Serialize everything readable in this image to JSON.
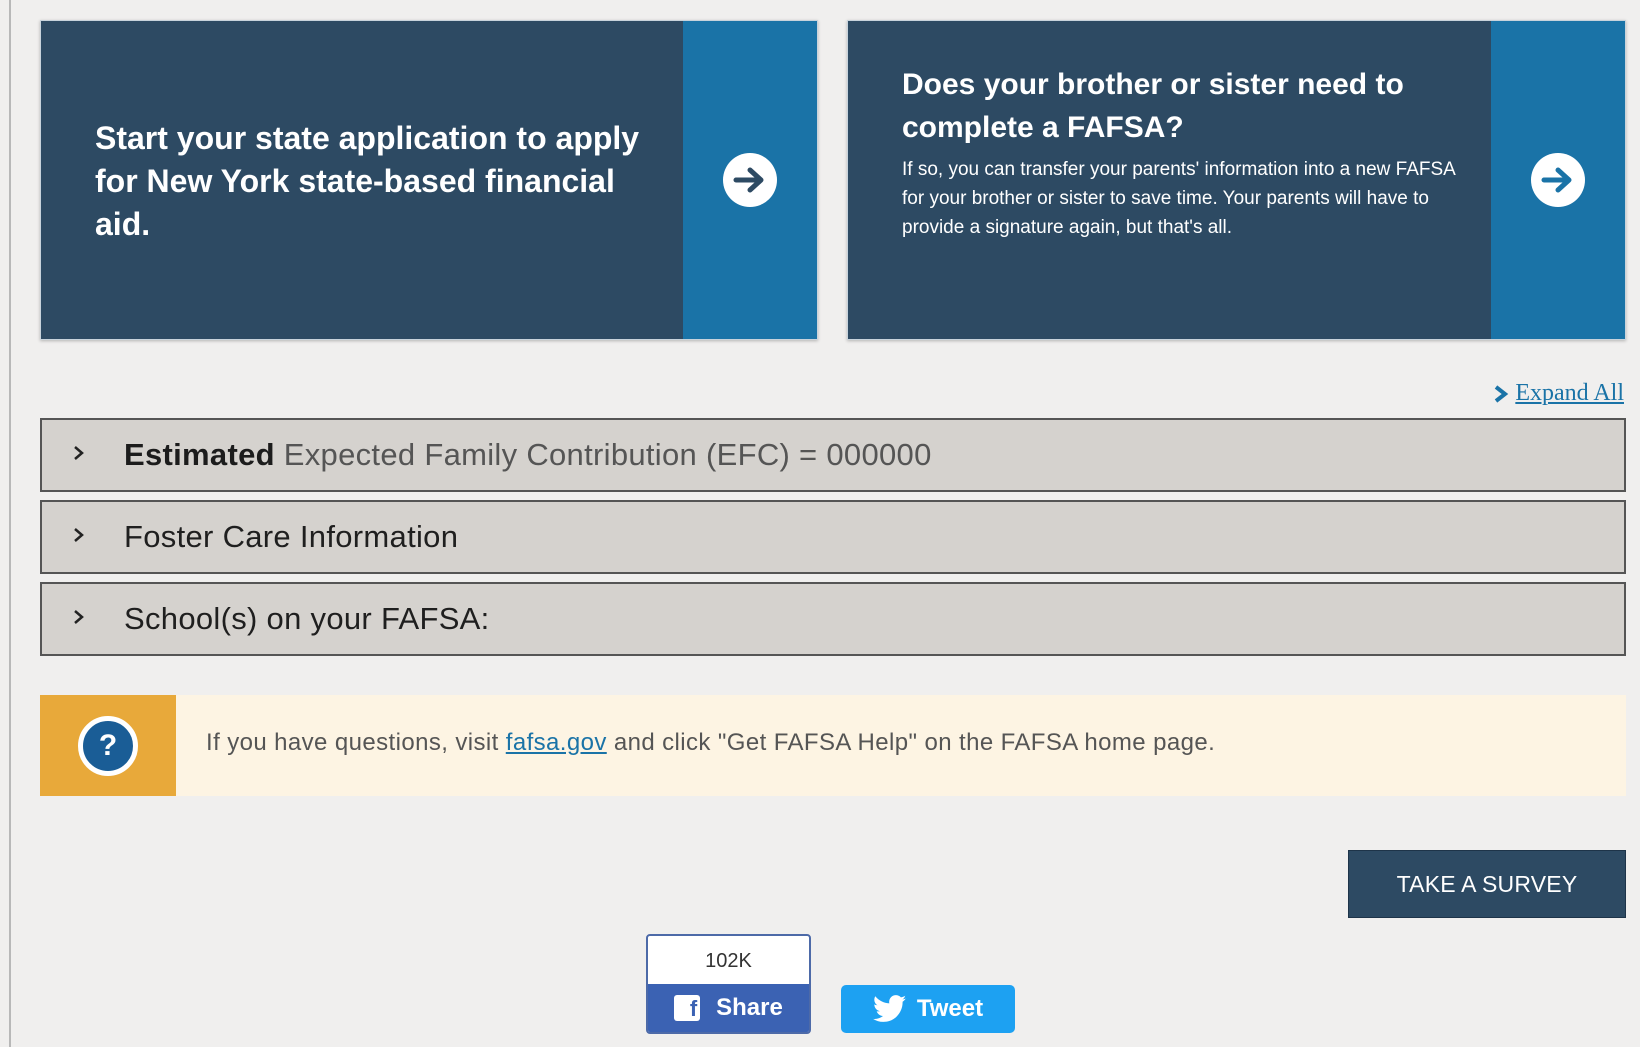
{
  "cards": {
    "state": {
      "text": "Start your state application to apply for New York state-based financial aid.",
      "arrow_icon": "arrow-right-circle-icon"
    },
    "sibling": {
      "title": "Does your brother or sister need to complete a FAFSA?",
      "body": "If so, you can transfer your parents' information into a new FAFSA for your brother or sister to save time. Your parents will have to provide a signature again, but that's all.",
      "arrow_icon": "arrow-right-circle-icon"
    }
  },
  "expand_all": {
    "label": "Expand All"
  },
  "accordion": {
    "efc": {
      "bold": "Estimated",
      "rest": " Expected Family Contribution (EFC) = 000000"
    },
    "foster": {
      "label": "Foster Care Information"
    },
    "schools": {
      "label": "School(s) on your FAFSA:"
    }
  },
  "help": {
    "icon_glyph": "?",
    "prefix": "If you have questions, visit ",
    "link": "fafsa.gov",
    "suffix": " and click \"Get FAFSA Help\" on the FAFSA home page."
  },
  "survey": {
    "label": "TAKE A SURVEY"
  },
  "social": {
    "share_count": "102K",
    "share_label": "Share",
    "tweet_label": "Tweet"
  },
  "colors": {
    "navy": "#2d4a63",
    "blue": "#1a73a7",
    "gold": "#e8a93a",
    "facebook": "#3b62b3",
    "twitter": "#1da1f2"
  }
}
